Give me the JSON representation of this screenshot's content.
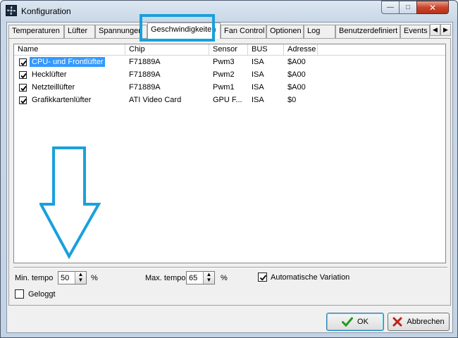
{
  "window": {
    "title": "Konfiguration",
    "title_icon": "fan-app-icon"
  },
  "title_buttons": {
    "minimize": "—",
    "maximize": "□",
    "close": "✕"
  },
  "tabs": [
    {
      "label": "Temperaturen"
    },
    {
      "label": "Lüfter"
    },
    {
      "label": "Spannungen"
    },
    {
      "label": "Geschwindigkeiten",
      "active": true
    },
    {
      "label": "Fan Control"
    },
    {
      "label": "Optionen"
    },
    {
      "label": "Log"
    },
    {
      "label": "Benutzerdefiniert"
    },
    {
      "label": "Events"
    }
  ],
  "tab_scroll": {
    "left": "◀",
    "right": "▶"
  },
  "list": {
    "columns": [
      "Name",
      "Chip",
      "Sensor",
      "BUS",
      "Adresse"
    ],
    "rows": [
      {
        "checked": true,
        "name": "CPU- und Frontlüfter",
        "chip": "F71889A",
        "sensor": "Pwm3",
        "bus": "ISA",
        "adresse": "$A00",
        "selected": true
      },
      {
        "checked": true,
        "name": "Hecklüfter",
        "chip": "F71889A",
        "sensor": "Pwm2",
        "bus": "ISA",
        "adresse": "$A00"
      },
      {
        "checked": true,
        "name": "Netzteillüfter",
        "chip": "F71889A",
        "sensor": "Pwm1",
        "bus": "ISA",
        "adresse": "$A00"
      },
      {
        "checked": true,
        "name": "Grafikkartenlüfter",
        "chip": "ATI Video Card",
        "sensor": "GPU F...",
        "bus": "ISA",
        "adresse": "$0"
      }
    ]
  },
  "controls": {
    "min_tempo_label": "Min. tempo",
    "min_tempo_value": "50",
    "min_tempo_unit": "%",
    "max_tempo_label": "Max. tempo",
    "max_tempo_value": "65",
    "max_tempo_unit": "%",
    "auto_variation_label": "Automatische Variation",
    "auto_variation_checked": true,
    "logged_label": "Geloggt",
    "logged_checked": false
  },
  "buttons": {
    "ok": "OK",
    "cancel": "Abbrechen"
  },
  "colors": {
    "annotation": "#1aa0dc",
    "selection": "#3399ff",
    "ok_check": "#1f9a1f",
    "cancel_x": "#c0201a"
  }
}
